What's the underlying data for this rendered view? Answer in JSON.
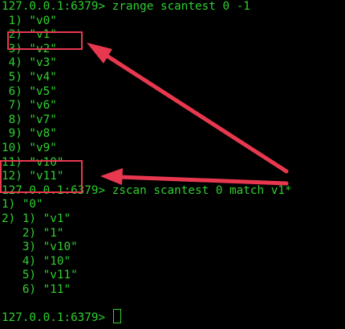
{
  "terminal": {
    "colors": {
      "background": "#000000",
      "text": "#2fd02f",
      "annotation": "#e8384f"
    },
    "lines": [
      "127.0.0.1:6379> zrange scantest 0 -1",
      " 1) \"v0\"",
      " 2) \"v1\"",
      " 3) \"v2\"",
      " 4) \"v3\"",
      " 5) \"v4\"",
      " 6) \"v5\"",
      " 7) \"v6\"",
      " 8) \"v7\"",
      " 9) \"v8\"",
      "10) \"v9\"",
      "11) \"v10\"",
      "12) \"v11\"",
      "127.0.0.1:6379> zscan scantest 0 match v1*",
      "1) \"0\"",
      "2) 1) \"v1\"",
      "   2) \"1\"",
      "   3) \"v10\"",
      "   4) \"10\"",
      "   5) \"v11\"",
      "   6) \"11\""
    ],
    "prompt": "127.0.0.1:6379> "
  }
}
